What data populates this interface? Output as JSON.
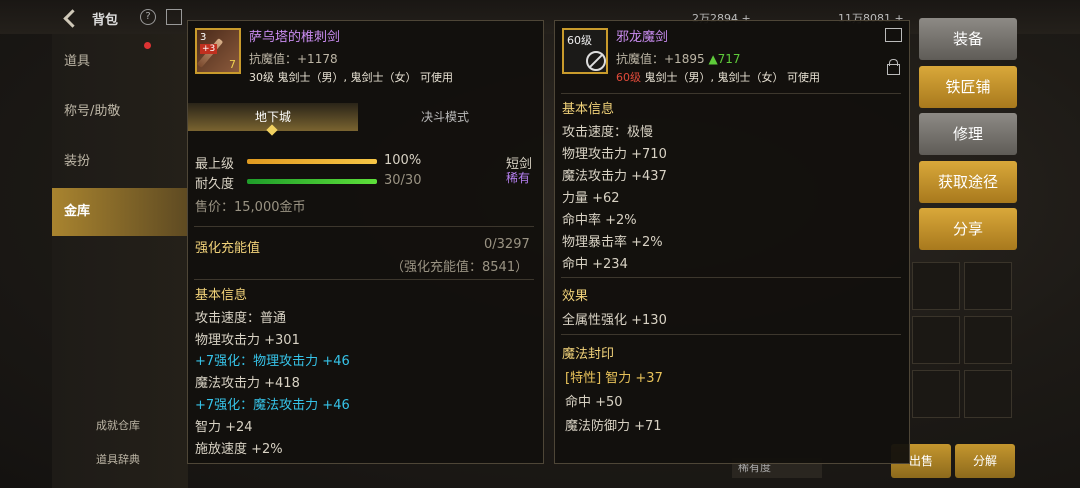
{
  "topbar": {
    "title": "背包",
    "help_symbol": "?",
    "stat_left": "2万2894 +",
    "stat_right": "11万8081 +"
  },
  "sidebar": {
    "items": [
      {
        "label": "道具"
      },
      {
        "label": "称号/助敬"
      },
      {
        "label": "装扮"
      },
      {
        "label": "金库"
      }
    ],
    "links": [
      {
        "label": "成就仓库"
      },
      {
        "label": "道具辞典"
      }
    ]
  },
  "bottom": {
    "sort_label": "稀有度",
    "sell_label": "出售",
    "decompose_label": "分解"
  },
  "left_item": {
    "name": "萨乌塔的椎刺剑",
    "resistance": "抗魔值：+1178",
    "requirement": "30级 鬼剑士（男）, 鬼剑士（女） 可使用",
    "icon_level": "3",
    "icon_badge": "+3",
    "icon_plus": "7",
    "tabs": [
      {
        "label": "地下城"
      },
      {
        "label": "决斗模式"
      }
    ],
    "grade_label": "最上级",
    "grade_value": "100%",
    "grade_fill": 1.0,
    "durability_label": "耐久度",
    "durability_value": "30/30",
    "durability_fill": 1.0,
    "weapon_type": "短剑",
    "rarity": "稀有",
    "price": "售价：15,000金币",
    "enhance_title": "强化充能值",
    "enhance_count": "0/3297",
    "enhance_total": "（强化充能值：8541）",
    "section_title": "基本信息",
    "stats": [
      {
        "text": "攻击速度：普通",
        "color": "normal"
      },
      {
        "text": "物理攻击力 +301",
        "color": "normal"
      },
      {
        "text": "+7强化：物理攻击力 +46",
        "color": "cyan"
      },
      {
        "text": "魔法攻击力 +418",
        "color": "normal"
      },
      {
        "text": "+7强化：魔法攻击力 +46",
        "color": "cyan"
      },
      {
        "text": "智力 +24",
        "color": "normal"
      },
      {
        "text": "施放速度 +2%",
        "color": "normal"
      }
    ]
  },
  "right_item": {
    "name": "邪龙魔剑",
    "icon_level": "60级",
    "resistance": "抗魔值：+1895",
    "resistance_up": "▲717",
    "requirement_level": "60级",
    "requirement": " 鬼剑士（男）, 鬼剑士（女） 可使用",
    "section_title": "基本信息",
    "stats": [
      "攻击速度：极慢",
      "物理攻击力 +710",
      "魔法攻击力 +437",
      "力量 +62",
      "命中率 +2%",
      "物理暴击率 +2%",
      "命中 +234"
    ],
    "effect_title": "效果",
    "effect": "全属性强化 +130",
    "seal_title": "魔法封印",
    "seal_stats": [
      {
        "text": "[特性] 智力 +37",
        "color": "gold"
      },
      {
        "text": "命中 +50",
        "color": "normal"
      },
      {
        "text": "魔法防御力 +71",
        "color": "normal"
      }
    ]
  },
  "actions": [
    {
      "label": "装备",
      "style": "gray"
    },
    {
      "label": "铁匠铺",
      "style": "gold"
    },
    {
      "label": "修理",
      "style": "gray"
    },
    {
      "label": "获取途径",
      "style": "gold"
    },
    {
      "label": "分享",
      "style": "gold"
    }
  ]
}
